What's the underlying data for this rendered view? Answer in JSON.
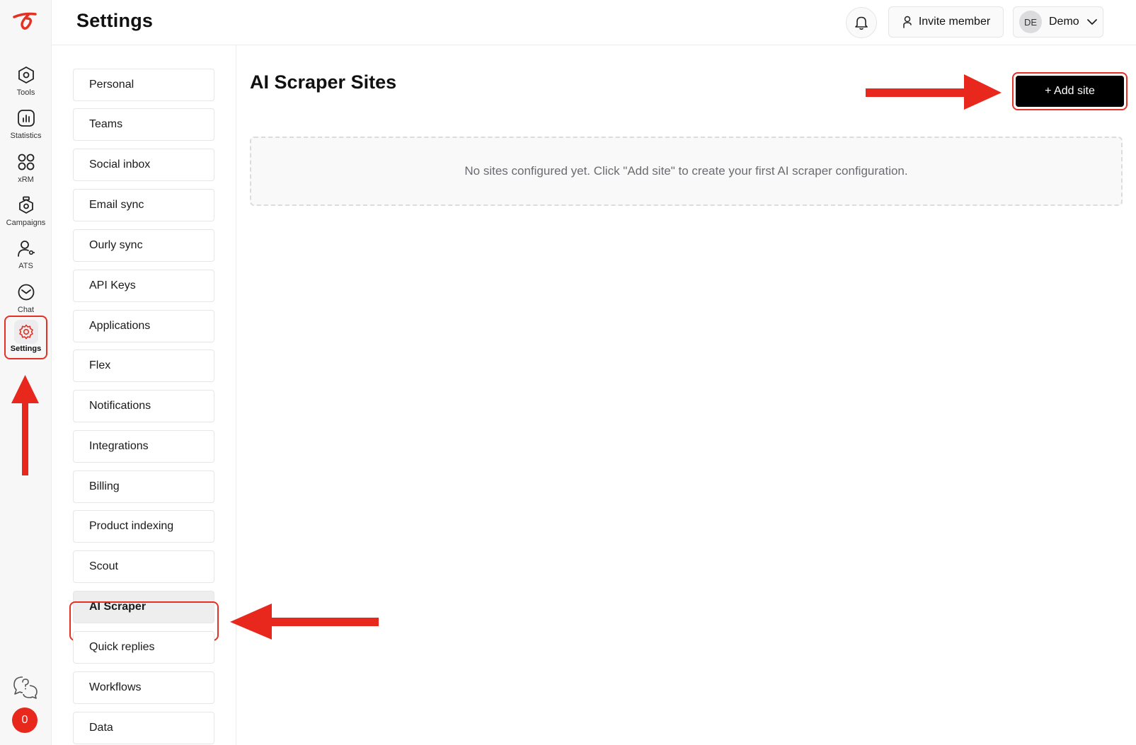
{
  "header": {
    "title": "Settings",
    "invite_label": "Invite member",
    "user_initials": "DE",
    "user_name": "Demo"
  },
  "rail": {
    "items": [
      {
        "label": "Tools",
        "icon": "hexagon-icon"
      },
      {
        "label": "Statistics",
        "icon": "bar-chart-icon"
      },
      {
        "label": "xRM",
        "icon": "grid-icon"
      },
      {
        "label": "Campaigns",
        "icon": "campaign-icon"
      },
      {
        "label": "ATS",
        "icon": "user-key-icon"
      },
      {
        "label": "Chat",
        "icon": "chat-icon"
      },
      {
        "label": "Settings",
        "icon": "gear-icon",
        "active": true
      }
    ],
    "notification_count": "0"
  },
  "settings_nav": {
    "items": [
      "Personal",
      "Teams",
      "Social inbox",
      "Email sync",
      "Ourly sync",
      "API Keys",
      "Applications",
      "Flex",
      "Notifications",
      "Integrations",
      "Billing",
      "Product indexing",
      "Scout",
      "AI Scraper",
      "Quick replies",
      "Workflows",
      "Data"
    ],
    "active": "AI Scraper"
  },
  "main": {
    "title": "AI Scraper Sites",
    "add_button": "+ Add site",
    "empty_message": "No sites configured yet. Click \"Add site\" to create your first AI scraper configuration."
  },
  "colors": {
    "accent": "#e33124",
    "primary_button": "#000000",
    "badge": "#e8281d"
  }
}
